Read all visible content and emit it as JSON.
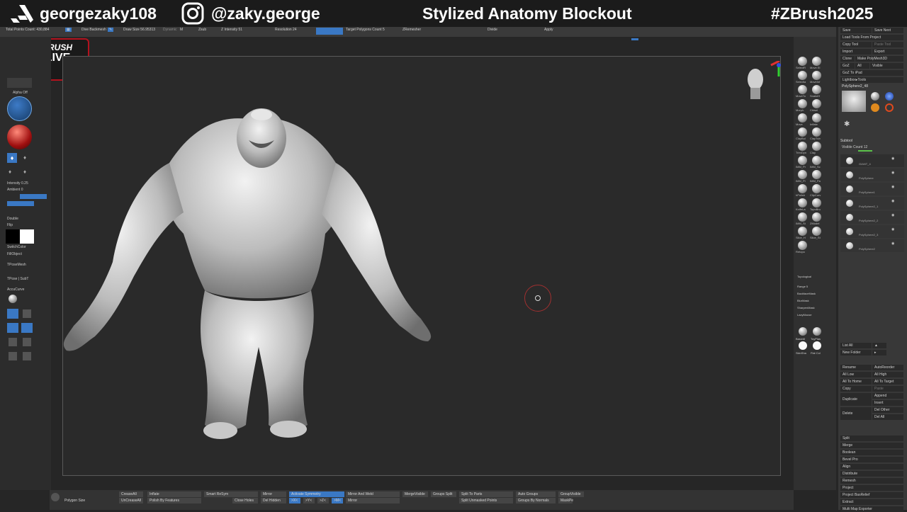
{
  "banner": {
    "username": "georgezaky108",
    "instagram": "@zaky.george",
    "title": "Stylized Anatomy Blockout",
    "hashtag": "#ZBrush2025"
  },
  "live_badge": {
    "brand": "ZBRUSH",
    "live": "LIVE"
  },
  "topbar": {
    "total_points": "Total Points Count: 430,884",
    "dive_backmesh": "Dive Backmesh",
    "draw_size": "Draw Size 56.95313",
    "dynamic": "Dynamic",
    "m": "M",
    "zsub": "Zsub",
    "z_intensity": "Z Intensity 51",
    "resolution": "Resolution 24",
    "target_polygons": "Target Polygons Count 5",
    "zremesher": "ZRemesher",
    "divide": "Divide",
    "apply": "Apply"
  },
  "leftbar": {
    "alpha_off": "Alpha Off",
    "intensity": "Intensity 0.25",
    "ambient": "Ambient 0",
    "double": "Double",
    "flip": "Flip",
    "switch_color": "SwitchColor",
    "fill_object": "FillObject",
    "tpose_mesh": "TPoseMesh",
    "tpose_subt": "TPose | SubT",
    "accu_curve": "AccuCurve"
  },
  "brushes": {
    "items": [
      "SelectR",
      "Move El",
      "Selectla",
      "MoveInf",
      "MoveTo",
      "SnakeH",
      "Morph",
      "Chisel",
      "Move",
      "Inflate",
      "ClayBui",
      "ClayTub",
      "TrimDyn",
      "Clay",
      "IMM_Pr",
      "IMM_Sc",
      "IMM_Pl",
      "IMM_Pa",
      "hPolish",
      "ClipCurv",
      "KnifeLa",
      "TopoBru",
      "IMM_St",
      "ZModel",
      "Slice_H",
      "Slice_St",
      "Retopo"
    ],
    "topological": "Topological",
    "range": "Range 5",
    "backface_mask": "BackfaceMask",
    "blur_mask": "BlurMask",
    "sharpen_mask": "SharpenMask",
    "lazy_mouse": "LazyMouse",
    "basic_mat": "BasicM",
    "toy_plastic": "ToyPlas",
    "skin_shade": "SkinSha",
    "flat_color": "Flat Col"
  },
  "rightpanel": {
    "save": "Save",
    "save_next": "Save Next",
    "load_tools": "Load Tools From Project",
    "copy_tool": "Copy Tool",
    "paste_tool": "Paste Tool",
    "import": "Import",
    "export": "Export",
    "clone": "Clone",
    "make_polymesh": "Make PolyMesh3D",
    "goz": "GoZ",
    "all": "All",
    "visible": "Visible",
    "go_to_ipad": "GoZ To iPad",
    "lightbox_tools": "Lightbox▸Tools",
    "polysphere": "PolySphere2_48",
    "subtool": "Subtool",
    "visible_count": "Visible Count 12",
    "subtool_names": [
      "GIANT_4",
      "PolySphere",
      "PolySphere1",
      "PolySphere2_1",
      "PolySphere2_2",
      "PolySphere2_3",
      "PolySphere2"
    ],
    "list_all": "List All",
    "new_folder": "New Folder",
    "rename": "Rename",
    "auto_reorder": "AutoReorder",
    "all_low": "All Low",
    "all_high": "All High",
    "all_to_home": "All To Home",
    "all_to_target": "All To Target",
    "copy": "Copy",
    "paste": "Paste",
    "duplicate": "Duplicate",
    "append": "Append",
    "insert": "Insert",
    "delete": "Delete",
    "del_other": "Del Other",
    "del_all": "Del All",
    "split": "Split",
    "merge": "Merge",
    "boolean": "Boolean",
    "bevel_pro": "Bevel Pro",
    "align": "Align",
    "distribute": "Distribute",
    "remesh": "Remesh",
    "project": "Project",
    "project_basrelief": "Project BasRelief",
    "extract": "Extract",
    "multimap": "Multi Map Exporter"
  },
  "bottombar": {
    "polygon_size": "Polygon Size",
    "crease_all": "CreaseAll",
    "uncrease_all": "UnCreaseAll",
    "inflate": "Inflate",
    "polish_features": "Polish By Features",
    "smart_resym": "Smart ReSym",
    "close_holes": "Close Holes",
    "mirror": "Mirror",
    "del_hidden": "Del Hidden",
    "activate_symmetry": "Activate Symmetry",
    "mirror_and_weld": "Mirror And Weld",
    "mirror2": "Mirror",
    "merge_visible": "MergeVisible",
    "groups_split": "Groups Split",
    "split_to_parts": "Split To Parts",
    "split_unmasked": "Split Unmasked Points",
    "auto_groups": "Auto Groups",
    "groups_by_normals": "Groups By Normals",
    "group_visible": "GroupVisible",
    "maskpe": "MaskPe",
    "axis_x": ">X<",
    "axis_y": ">Y<",
    "axis_z": ">Z<",
    "axis_m": ">M<"
  },
  "colors": {
    "accent_blue": "#3a78c4",
    "live_red": "#b3121e",
    "slider_green": "#5cc24a"
  }
}
